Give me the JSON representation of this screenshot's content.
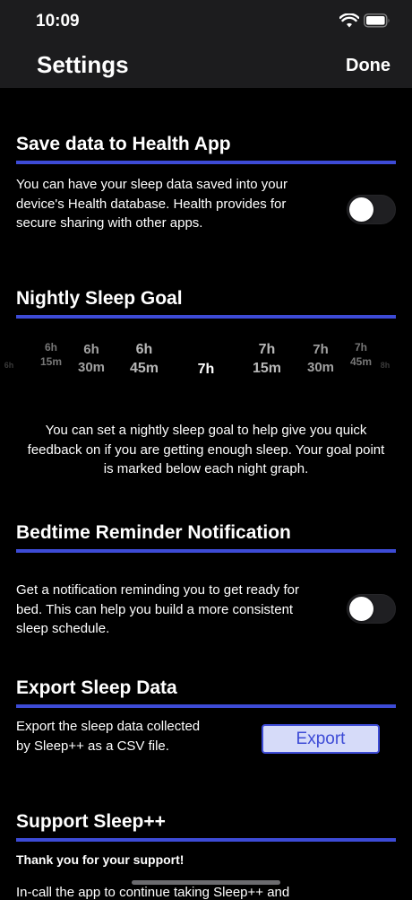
{
  "status_bar": {
    "time": "10:09"
  },
  "nav": {
    "title": "Settings",
    "done_label": "Done"
  },
  "health": {
    "title": "Save data to Health App",
    "line1": "You can have your sleep data saved into your",
    "line2": "device's Health database. Health provides for",
    "line3": "secure sharing with other apps.",
    "toggle_on": false
  },
  "sleep_goal": {
    "title": "Nightly Sleep Goal",
    "picker": [
      {
        "top": "6h",
        "bottom": ""
      },
      {
        "top": "6h",
        "bottom": "15m"
      },
      {
        "top": "6h",
        "bottom": "30m"
      },
      {
        "top": "6h",
        "bottom": "45m"
      },
      {
        "top": "7h",
        "bottom": ""
      },
      {
        "top": "7h",
        "bottom": "15m"
      },
      {
        "top": "7h",
        "bottom": "30m"
      },
      {
        "top": "7h",
        "bottom": "45m"
      },
      {
        "top": "8h",
        "bottom": ""
      }
    ],
    "selected": "7h",
    "description": "You can set a nightly sleep goal to help give you quick feedback on if you are getting enough sleep. Your goal point is marked below each night graph."
  },
  "bedtime": {
    "title": "Bedtime Reminder Notification",
    "line1": "Get a notification reminding you to get ready for",
    "line2": "bed.  This can help you build a more consistent",
    "line3": "sleep schedule.",
    "toggle_on": false
  },
  "export": {
    "title": "Export Sleep Data",
    "line1": "Export the sleep data collected",
    "line2": "by Sleep++ as a CSV file.",
    "button_label": "Export"
  },
  "support": {
    "title": "Support Sleep++",
    "thanks": "Thank you for your support!",
    "partial": "In-call the app to continue taking Sleep++ and"
  },
  "colors": {
    "accent": "#3d4bd6",
    "button_bg": "#d6dbf9",
    "topbar": "#1c1c1e"
  }
}
